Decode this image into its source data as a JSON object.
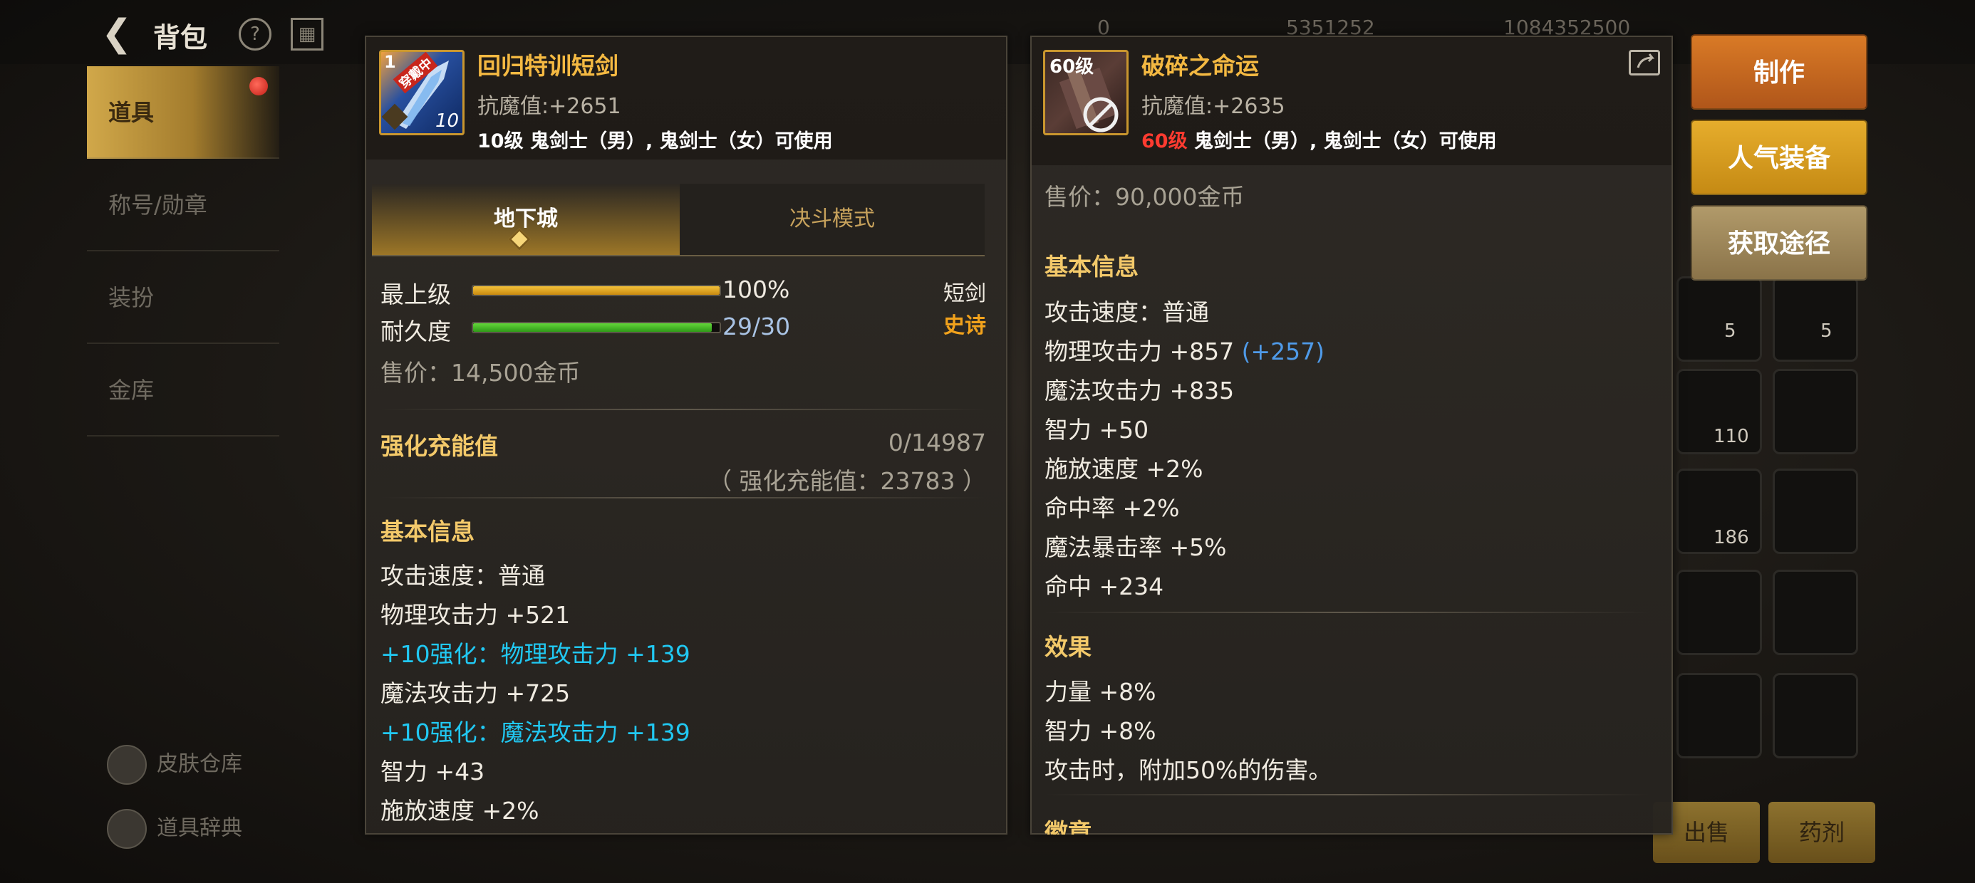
{
  "topbar": {
    "title": "背包",
    "currency1": "0",
    "currency2": "5351252",
    "currency3": "1084352500"
  },
  "sidebar": {
    "items": [
      {
        "label": "道具",
        "active": true
      },
      {
        "label": "称号/勋章"
      },
      {
        "label": "装扮"
      },
      {
        "label": "金库"
      }
    ],
    "bottom": [
      {
        "label": "皮肤仓库"
      },
      {
        "label": "道具辞典"
      }
    ]
  },
  "left_item": {
    "icon_level": "1",
    "icon_badge": "穿戴中",
    "icon_plus": "10",
    "name": "回归特训短剑",
    "resist_label": "抗魔值:",
    "resist_value": "+2651",
    "usable": "10级 鬼剑士（男）, 鬼剑士（女）可使用",
    "tabs": [
      "地下城",
      "决斗模式"
    ],
    "grade_label": "最上级",
    "grade_value": "100%",
    "grade_percent": 100,
    "durability_label": "耐久度",
    "durability_value": "29/30",
    "durability_percent": 96.7,
    "weapon_type": "短剑",
    "rarity": "史诗",
    "price": "售价：14,500金币",
    "charge_label": "强化充能值",
    "charge_value": "0/14987",
    "charge_sub": "（ 强化充能值：23783 ）",
    "basic_info_title": "基本信息",
    "stats": [
      {
        "text": "攻击速度：普通",
        "style": "normal"
      },
      {
        "text": "物理攻击力 +521",
        "style": "normal"
      },
      {
        "text": "+10强化：物理攻击力 +139",
        "style": "cyan"
      },
      {
        "text": "魔法攻击力 +725",
        "style": "normal"
      },
      {
        "text": "+10强化：魔法攻击力 +139",
        "style": "cyan"
      },
      {
        "text": "智力 +43",
        "style": "normal"
      },
      {
        "text": "施放速度 +2%",
        "style": "normal"
      }
    ]
  },
  "right_item": {
    "icon_level": "60级",
    "name": "破碎之命运",
    "resist_label": "抗魔值:",
    "resist_value": "+2635",
    "usable_level": "60级",
    "usable": " 鬼剑士（男）, 鬼剑士（女）可使用",
    "price": "售价：90,000金币",
    "basic_info_title": "基本信息",
    "stats": [
      {
        "text": "攻击速度：普通"
      },
      {
        "text": "物理攻击力 +857",
        "extra": "(+257)"
      },
      {
        "text": "魔法攻击力 +835"
      },
      {
        "text": "智力 +50"
      },
      {
        "text": "施放速度 +2%"
      },
      {
        "text": "命中率 +2%"
      },
      {
        "text": "魔法暴击率 +5%"
      },
      {
        "text": "命中 +234"
      }
    ],
    "effect_title": "效果",
    "effects": [
      "力量 +8%",
      "智力 +8%",
      "攻击时，附加50%的伤害。"
    ],
    "cut_title": "徽章"
  },
  "actions": [
    {
      "label": "制作",
      "color": "#c4661c"
    },
    {
      "label": "人气装备",
      "color": "#d4981c"
    },
    {
      "label": "获取途径",
      "color": "#9a8356"
    }
  ],
  "bottom_buttons": [
    "出售",
    "药剂"
  ],
  "grid_counts": [
    "5",
    "5",
    "110",
    "186"
  ]
}
